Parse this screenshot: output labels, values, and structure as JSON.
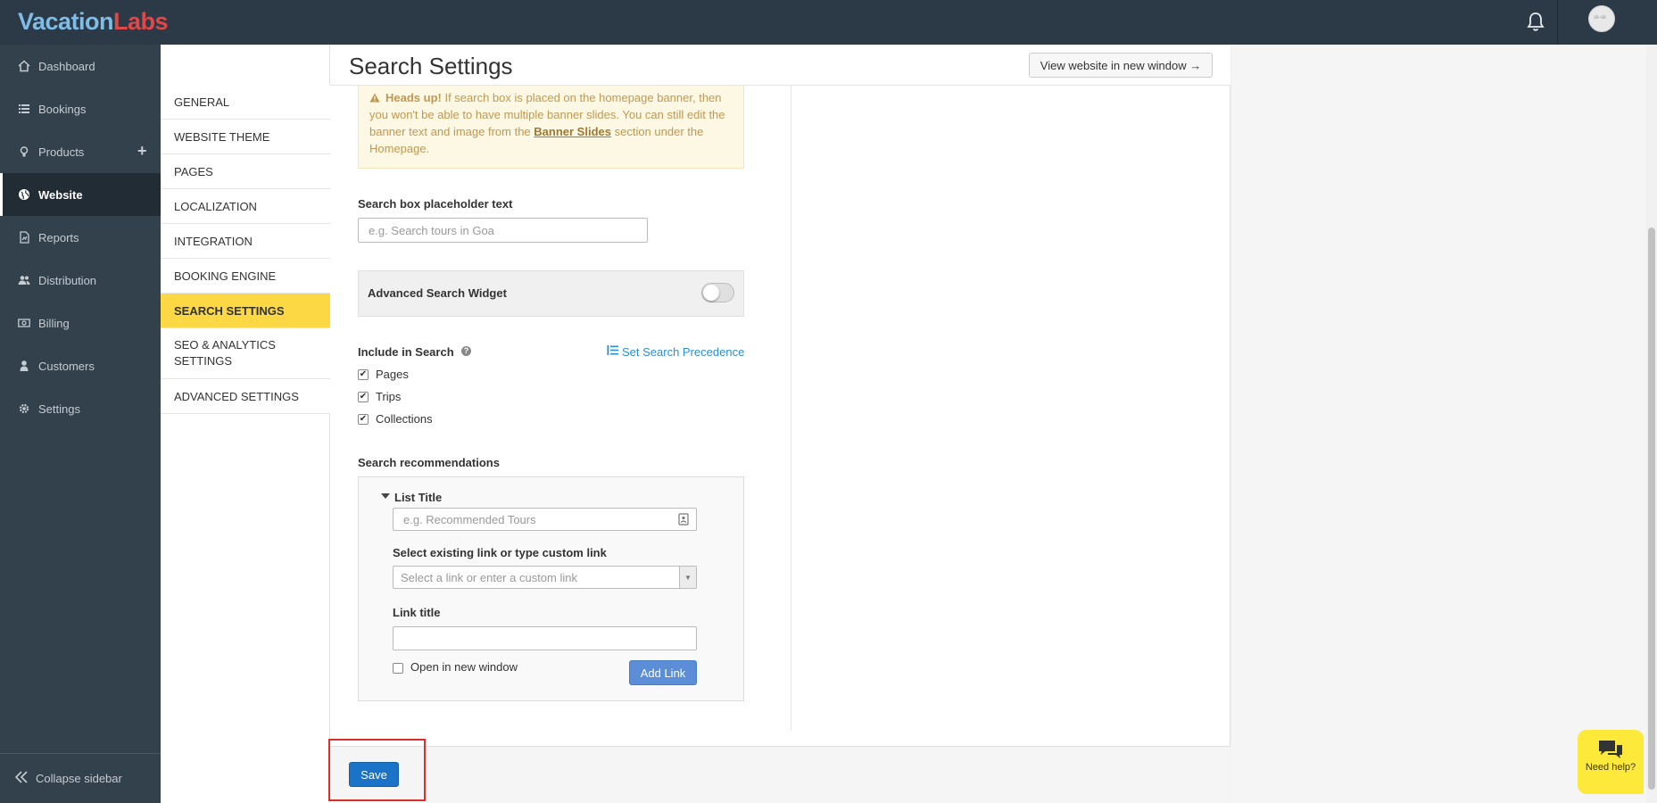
{
  "header": {
    "logo_part1": "Vacation",
    "logo_part2": "Labs",
    "avatar_text": "sk-sk"
  },
  "sidebar": {
    "items": [
      {
        "label": "Dashboard",
        "icon": "dashboard-icon"
      },
      {
        "label": "Bookings",
        "icon": "list-icon"
      },
      {
        "label": "Products",
        "icon": "lightbulb-icon"
      },
      {
        "label": "Website",
        "icon": "globe-icon"
      },
      {
        "label": "Reports",
        "icon": "report-icon"
      },
      {
        "label": "Distribution",
        "icon": "users-icon"
      },
      {
        "label": "Billing",
        "icon": "money-icon"
      },
      {
        "label": "Customers",
        "icon": "user-icon"
      },
      {
        "label": "Settings",
        "icon": "gear-icon"
      }
    ],
    "plus": "+",
    "collapse_label": "Collapse sidebar"
  },
  "subnav": {
    "items": [
      "GENERAL",
      "WEBSITE THEME",
      "PAGES",
      "LOCALIZATION",
      "INTEGRATION",
      "BOOKING ENGINE",
      "SEARCH SETTINGS",
      "SEO & ANALYTICS SETTINGS",
      "ADVANCED SETTINGS"
    ],
    "active": "SEARCH SETTINGS"
  },
  "page": {
    "title": "Search Settings",
    "view_website_button": "View website in new window →"
  },
  "alert": {
    "heading": "Heads up!",
    "text_before_link": " If search box is placed on the homepage banner, then you won't be able to have multiple banner slides. You can still edit the banner text and image from the ",
    "link_text": "Banner Slides",
    "text_after_link": " section under the Homepage."
  },
  "search_box": {
    "label": "Search box placeholder text",
    "placeholder": "e.g. Search tours in Goa"
  },
  "advanced_widget": {
    "label": "Advanced Search Widget",
    "enabled": false
  },
  "include_in_search": {
    "label": "Include in Search",
    "precedence_link": "Set Search Precedence",
    "options": [
      {
        "label": "Pages",
        "checked": true
      },
      {
        "label": "Trips",
        "checked": true
      },
      {
        "label": "Collections",
        "checked": true
      }
    ]
  },
  "recommendations": {
    "label": "Search recommendations",
    "list_title_label": "List Title",
    "list_title_placeholder": "e.g. Recommended Tours",
    "link_select_label": "Select existing link or type custom link",
    "link_select_placeholder": "Select a link or enter a custom link",
    "link_title_label": "Link title",
    "link_title_value": "",
    "open_new_window_label": "Open in new window",
    "open_new_window_checked": false,
    "add_link_button": "Add Link"
  },
  "footer": {
    "save_button": "Save"
  },
  "help_widget": {
    "label": "Need help?"
  },
  "colors": {
    "topbar": "#2b3a46",
    "sidebar": "#33414d",
    "active_subnav": "#fdd845",
    "save_button": "#1a73c7",
    "add_link_button": "#5b8ed6",
    "link": "#2a8fd0",
    "alert_bg": "#fcf8e3",
    "highlight_box": "#d9302c"
  }
}
